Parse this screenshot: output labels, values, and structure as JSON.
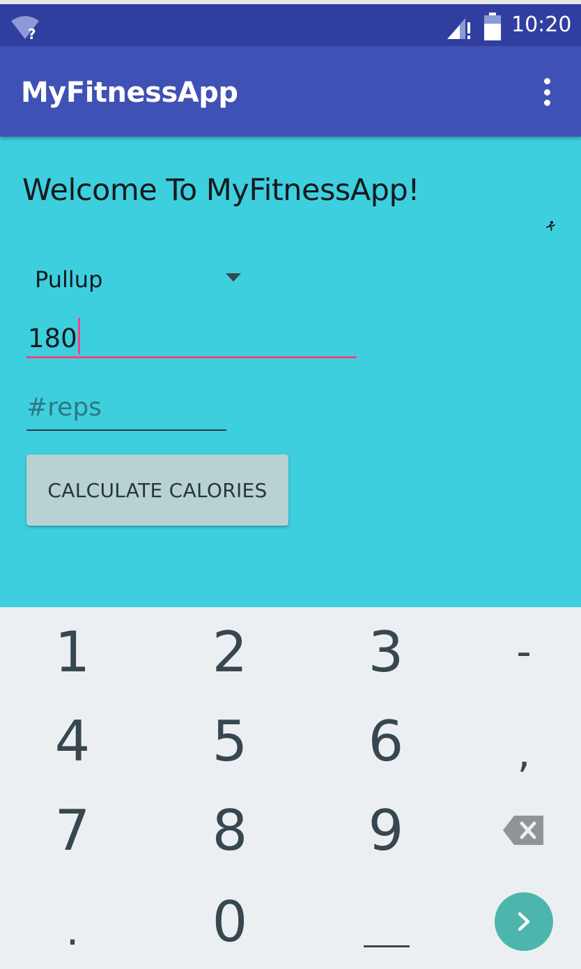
{
  "status_bar": {
    "time": "10:20",
    "wifi_icon": "wifi-unknown-icon",
    "signal_icon": "signal-no-data-icon",
    "battery_icon": "battery-icon"
  },
  "app_bar": {
    "title": "MyFitnessApp",
    "menu_icon": "more-vert-icon"
  },
  "main": {
    "welcome": "Welcome To MyFitnessApp!",
    "exercise_spinner": {
      "selected": "Pullup"
    },
    "weight_field": {
      "value": "180"
    },
    "reps_field": {
      "value": "",
      "placeholder": "#reps"
    },
    "calculate_button": {
      "label": "CALCULATE CALORIES"
    }
  },
  "keyboard": {
    "keys": {
      "k1": "1",
      "k2": "2",
      "k3": "3",
      "dash": "-",
      "k4": "4",
      "k5": "5",
      "k6": "6",
      "comma": ",",
      "k7": "7",
      "k8": "8",
      "k9": "9",
      "period": ".",
      "k0": "0"
    },
    "backspace_icon": "backspace-icon",
    "next_icon": "chevron-right-icon",
    "space_icon": "space-bar-icon"
  },
  "colors": {
    "primary": "#3F51B5",
    "primary_dark": "#303F9F",
    "accent": "#FF4081",
    "background": "#3ECFDE",
    "keyboard": "#ECEFF1",
    "next_key": "#4DB6AC"
  }
}
